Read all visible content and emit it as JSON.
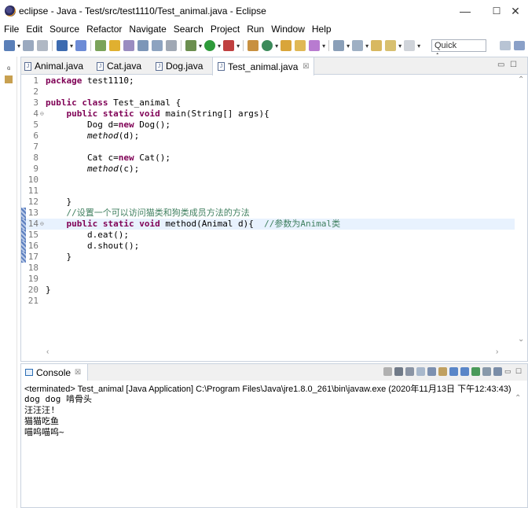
{
  "window": {
    "title": "eclipse - Java - Test/src/test1110/Test_animal.java - Eclipse",
    "minimize": "—",
    "maximize": "☐",
    "close": "✕"
  },
  "menu": [
    "File",
    "Edit",
    "Source",
    "Refactor",
    "Navigate",
    "Search",
    "Project",
    "Run",
    "Window",
    "Help"
  ],
  "toolbar": {
    "quick_access": "Quick Access"
  },
  "editor": {
    "tabs": [
      {
        "label": "Animal.java",
        "active": false
      },
      {
        "label": "Cat.java",
        "active": false
      },
      {
        "label": "Dog.java",
        "active": false
      },
      {
        "label": "Test_animal.java",
        "active": true,
        "close": "☒"
      }
    ],
    "lines": [
      {
        "n": "1",
        "html": "<span class='kw'>package</span> test1110;"
      },
      {
        "n": "2",
        "html": ""
      },
      {
        "n": "3",
        "html": "<span class='kw'>public class</span> Test_animal {"
      },
      {
        "n": "4",
        "fold": "⊖",
        "html": "    <span class='kw'>public static void</span> main(String[] args){"
      },
      {
        "n": "5",
        "html": "        Dog d=<span class='kw'>new</span> Dog();"
      },
      {
        "n": "6",
        "html": "        <span class='it'>method</span>(d);"
      },
      {
        "n": "7",
        "html": ""
      },
      {
        "n": "8",
        "html": "        Cat c=<span class='kw'>new</span> Cat();"
      },
      {
        "n": "9",
        "html": "        <span class='it'>method</span>(c);"
      },
      {
        "n": "10",
        "html": ""
      },
      {
        "n": "11",
        "html": ""
      },
      {
        "n": "12",
        "html": "    }"
      },
      {
        "n": "13",
        "html": "    <span class='cm'>//设置一个可以访问猫类和狗类成员方法的方法</span>"
      },
      {
        "n": "14",
        "fold": "⊖",
        "current": true,
        "html": "    <span class='kw'>public static void</span> method(Animal d){  <span class='cm'>//参数为Animal类</span>"
      },
      {
        "n": "15",
        "html": "        d.eat();"
      },
      {
        "n": "16",
        "html": "        d.shout();"
      },
      {
        "n": "17",
        "html": "    }"
      },
      {
        "n": "18",
        "html": ""
      },
      {
        "n": "19",
        "html": ""
      },
      {
        "n": "20",
        "html": "}"
      },
      {
        "n": "21",
        "html": ""
      }
    ]
  },
  "console": {
    "tab_label": "Console",
    "tab_close": "☒",
    "terminated": "<terminated> Test_animal [Java Application] C:\\Program Files\\Java\\jre1.8.0_261\\bin\\javaw.exe (2020年11月13日 下午12:43:43)",
    "output": [
      "dog dog 啃骨头",
      "汪汪汪!",
      "猫猫吃鱼",
      "喵呜喵呜~"
    ]
  },
  "colors": {
    "keyword": "#7f0055",
    "comment": "#3f7f5f",
    "current_line": "#e8f2fe"
  }
}
